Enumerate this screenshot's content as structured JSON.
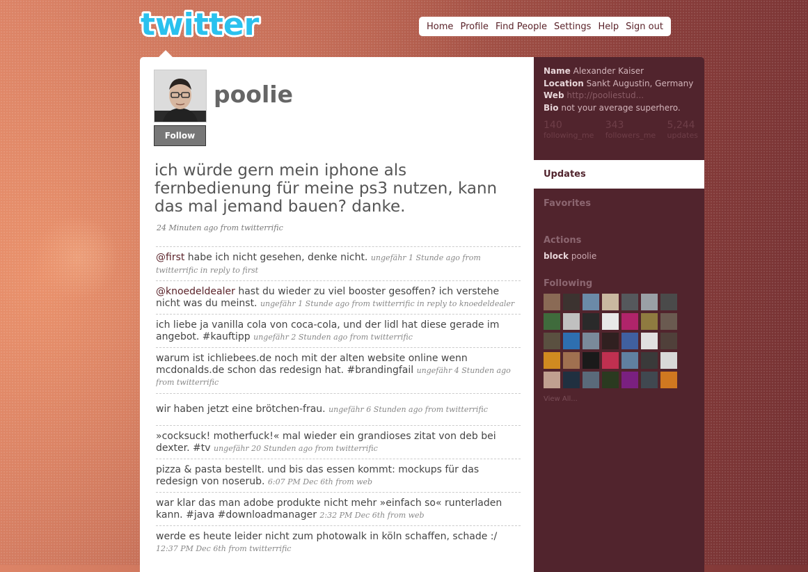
{
  "logo": {
    "text": "twitter",
    "color": "#2ac1ee"
  },
  "nav": {
    "items": [
      "Home",
      "Profile",
      "Find People",
      "Settings",
      "Help",
      "Sign out"
    ]
  },
  "profile": {
    "username": "poolie",
    "follow_label": "Follow",
    "latest_status": "ich würde gern mein iphone als fernbedienung für meine ps3 nutzen, kann das mal jemand bauen? danke.",
    "latest_meta": "24 Minuten ago from twitterrific"
  },
  "timeline": [
    {
      "mention": "@first",
      "text": " habe ich nicht gesehen, denke nicht.",
      "meta": "ungefähr 1 Stunde ago from twitterrific in reply to first"
    },
    {
      "mention": "@knoedeldealer",
      "text": " hast du wieder zu viel booster gesoffen? ich verstehe nicht was du meinst.",
      "meta": "ungefähr 1 Stunde ago from twitterrific in reply to knoedeldealer"
    },
    {
      "mention": "",
      "text": "ich liebe ja vanilla cola von coca-cola, und der lidl hat diese gerade im angebot. #kauftipp",
      "meta": "ungefähr 2 Stunden ago from twitterrific"
    },
    {
      "mention": "",
      "text": "warum ist ichliebees.de noch mit der alten website online wenn mcdonalds.de schon das redesign hat. #brandingfail",
      "meta": "ungefähr 4 Stunden ago from twitterrific"
    },
    {
      "mention": "",
      "text": "wir haben jetzt eine brötchen-frau.",
      "meta": "ungefähr 6 Stunden ago from twitterrific"
    },
    {
      "mention": "",
      "text": "»cocksuck! motherfuck!« mal wieder ein grandioses zitat von deb bei dexter. #tv",
      "meta": "ungefähr 20 Stunden ago from twitterrific"
    },
    {
      "mention": "",
      "text": "pizza & pasta bestellt. und bis das essen kommt: mockups für das redesign von noserub.",
      "meta": "6:07 PM Dec 6th from web"
    },
    {
      "mention": "",
      "text": "war klar das man adobe produkte nicht mehr »einfach so« runterladen kann. #java #downloadmanager",
      "meta": "2:32 PM Dec 6th from web"
    },
    {
      "mention": "",
      "text": "werde es heute leider nicht zum photowalk in köln schaffen, schade :/",
      "meta": "12:37 PM Dec 6th from twitterrific"
    }
  ],
  "sidebar": {
    "name_label": "Name",
    "name": "Alexander Kaiser",
    "location_label": "Location",
    "location": "Sankt Augustin, Germany",
    "web_label": "Web",
    "web": "http://pooliestud...",
    "bio_label": "Bio",
    "bio": "not your average superhero.",
    "stats": [
      {
        "value": "140",
        "label": "following_me"
      },
      {
        "value": "343",
        "label": "followers_me"
      },
      {
        "value": "5,244",
        "label": "updates"
      }
    ],
    "tab_updates": "Updates",
    "tab_favorites": "Favorites",
    "actions_title": "Actions",
    "block_word": "block",
    "block_user": "poolie",
    "following_title": "Following",
    "view_all": "View All..."
  },
  "following_colors": [
    "#8a6a55",
    "#3c3330",
    "#6b8aa8",
    "#c9b8a0",
    "#55585c",
    "#9aa0a6",
    "#4a4a4a",
    "#3f6b3c",
    "#c0c0c0",
    "#2a2a2a",
    "#e8e8e8",
    "#b0246a",
    "#8f7b40",
    "#6a5a50",
    "#5a5040",
    "#2e6fb0",
    "#7a8a9a",
    "#302020",
    "#4060a0",
    "#e0e0e0",
    "#50403a",
    "#d08a20",
    "#a07050",
    "#1a1a1a",
    "#c03050",
    "#6080a0",
    "#3a3a3a",
    "#d8d8d8",
    "#c0a090",
    "#203040",
    "#5a6a7a",
    "#2a3a20",
    "#7a2080",
    "#404850",
    "#d07820"
  ]
}
